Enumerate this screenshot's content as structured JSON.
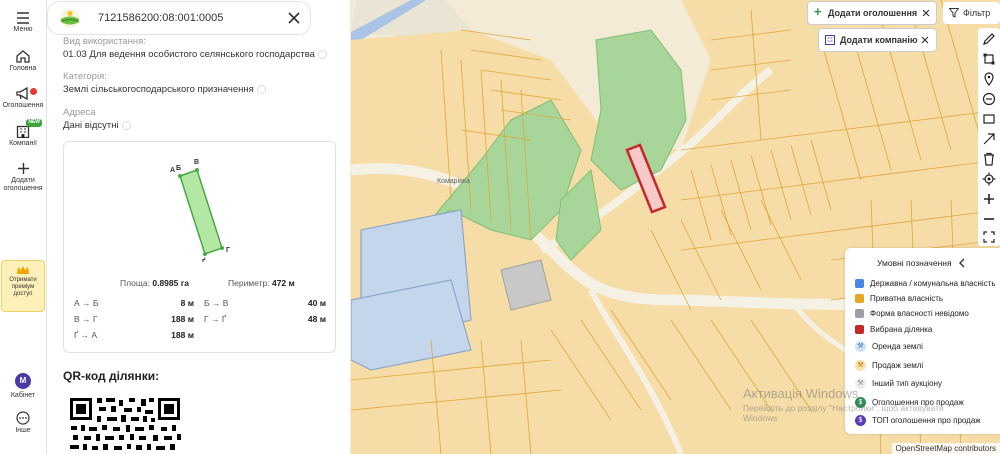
{
  "sidebar": {
    "menu": "Меню",
    "home": "Головна",
    "announcements": "Оголошення",
    "companies": "Компанії",
    "companies_badge": "NEW",
    "add": "Додати оголошення",
    "premium": "Отримати преміум доступ",
    "cabinet_avatar": "M",
    "cabinet": "Кабінет",
    "more": "Інше"
  },
  "panel": {
    "cadastral_number": "7121586200:08:001:0005",
    "usage_label": "Вид використання:",
    "usage_value": "01.03 Для ведення особистого селянського господарства",
    "category_label": "Категорія:",
    "category_value": "Землі сільськогосподарського призначення",
    "address_label": "Адреса",
    "address_value": "Дані відсутні",
    "plot_vertices": [
      "А",
      "Б",
      "В",
      "Г",
      "Ґ"
    ],
    "area_label": "Площа:",
    "area_value": "0.8985 га",
    "perimeter_label": "Периметр:",
    "perimeter_value": "472 м",
    "segments": [
      {
        "name": "А → Б",
        "value": "8 м"
      },
      {
        "name": "Б → В",
        "value": "40 м"
      },
      {
        "name": "В → Г",
        "value": "188 м"
      },
      {
        "name": "Г → Ґ",
        "value": "48 м"
      },
      {
        "name": "Ґ → А",
        "value": "188 м"
      }
    ],
    "qr_title": "QR-код ділянки:"
  },
  "map": {
    "add_listing": "Додати оголошення",
    "add_company": "Додати компанію",
    "filter": "Фільтр",
    "village_label": "Комарівка",
    "legend": {
      "title": "Умовні позначення",
      "items": [
        {
          "label": "Державна / комунальна власність",
          "color": "#4a86e8"
        },
        {
          "label": "Приватна власність",
          "color": "#e6a820"
        },
        {
          "label": "Форма власності невідомо",
          "color": "#9aa0a6"
        },
        {
          "label": "Вибрана ділянка",
          "color": "#c62828"
        },
        {
          "label": "Оренда землі",
          "color": "#cfe3f5"
        },
        {
          "label": "Продаж землі",
          "color": "#fbe0b0"
        },
        {
          "label": "Інший тип аукціону",
          "color": "#eeeeee"
        },
        {
          "label": "Оголошення про продаж",
          "color": "#2e8b57"
        },
        {
          "label": "ТОП оголошення про продаж",
          "color": "#5a3db8"
        }
      ]
    },
    "watermark_title": "Активація Windows",
    "watermark_line1": "Перейдіть до розділу \"Настройки\", щоб активувати",
    "watermark_line2": "Windows",
    "attribution": "OpenStreetMap contributors"
  },
  "colors": {
    "accent_green": "#2e9b4a",
    "accent_purple": "#4a3aa8",
    "selected_parcel": "#c62828",
    "parcel_fill": "#f3d79e",
    "parcel_stroke": "#e0a63a"
  }
}
